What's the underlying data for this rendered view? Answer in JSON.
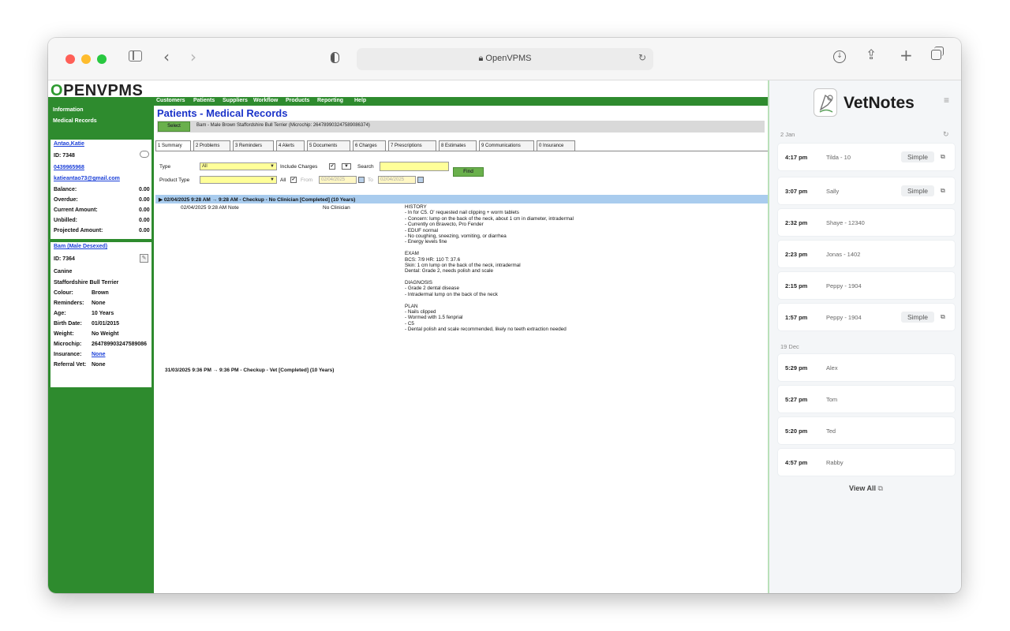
{
  "browser": {
    "url": "OpenVPMS",
    "colors": {
      "close": "#ff5f57",
      "minimize": "#febc2e",
      "maximize": "#28c840"
    }
  },
  "app": {
    "logo_o": "O",
    "logo_rest": "PENVPMS",
    "sidebar_links": [
      "Information",
      "Medical Records"
    ],
    "customer": {
      "name": "Antao,Katie",
      "id_label": "ID:",
      "id": "7348",
      "phone": "0439965968",
      "email": "katieantao73@gmail.com",
      "rows": [
        {
          "label": "Balance:",
          "value": "0.00"
        },
        {
          "label": "Overdue:",
          "value": "0.00"
        },
        {
          "label": "Current Amount:",
          "value": "0.00"
        },
        {
          "label": "Unbilled:",
          "value": "0.00"
        },
        {
          "label": "Projected Amount:",
          "value": "0.00"
        }
      ]
    },
    "patient": {
      "name": "Bam (Male Desexed)",
      "id_label": "ID:",
      "id": "7364",
      "species": "Canine",
      "breed": "Staffordshire Bull Terrier",
      "rows": [
        {
          "label": "Colour:",
          "value": "Brown"
        },
        {
          "label": "Reminders:",
          "value": "None"
        },
        {
          "label": "Age:",
          "value": "10 Years"
        },
        {
          "label": "Birth Date:",
          "value": "01/01/2015"
        },
        {
          "label": "Weight:",
          "value": "No Weight"
        },
        {
          "label": "Microchip:",
          "value": "264789903247589086"
        }
      ],
      "insurance_label": "Insurance:",
      "insurance_value": "None",
      "referral_label": "Referral Vet:",
      "referral_value": "None"
    },
    "menu": [
      "Customers",
      "Patients",
      "Suppliers",
      "Workflow",
      "Products",
      "Reporting",
      "Help"
    ],
    "page_title": "Patients - Medical Records",
    "select_button": "Select",
    "select_text": "Bam - Male Brown Staffordshire Bull Terrier (Microchip: 264789903247589086374)",
    "tabs": [
      "1 Summary",
      "2 Problems",
      "3 Reminders",
      "4 Alerts",
      "5 Documents",
      "6 Charges",
      "7 Prescriptions",
      "8 Estimates",
      "9 Communications",
      "0 Insurance"
    ],
    "filters": {
      "type_label": "Type",
      "type_value": "All",
      "include_charges": "Include Charges",
      "search_label": "Search",
      "product_type_label": "Product Type",
      "all_label": "All",
      "from_label": "From",
      "from_value": "02/04/2025",
      "to_label": "To",
      "to_value": "02/04/2025",
      "find_button": "Find",
      "check_mark": "✔"
    },
    "entry1": {
      "header": "02/04/2025 9:28 AM → 9:28 AM - Checkup - No Clinician [Completed] (10 Years)",
      "note_time": "02/04/2025 9:28 AM  Note",
      "note_clinician": "No Clinician",
      "history": [
        "HISTORY",
        "- In for C5. O' requested nail clipping + worm tablets",
        "- Concern: lump on the back of the neck, about 1 cm in diameter, intradermal",
        "- Currently on Bravecto, Pro Fender",
        "- EDUF normal",
        "- No coughing, sneezing, vomiting, or diarrhea",
        "- Energy levels fine",
        "",
        "EXAM",
        "BCS: 7/9    HR: 110    T: 37.6",
        "Skin: 1 cm lump on the back of the neck, intradermal",
        "Dental: Grade 2, needs polish and scale",
        "",
        "DIAGNOSIS",
        "- Grade 2 dental disease",
        "- Intradermal lump on the back of the neck",
        "",
        "PLAN",
        "- Nails clipped",
        "- Wormed with 1.5 fenprial",
        "- C5",
        "- Dental polish and scale recommended, likely no teeth extraction needed"
      ]
    },
    "entry2": {
      "header": "31/03/2025 9:36 PM → 9:36 PM - Checkup - Vet [Completed] (10 Years)"
    }
  },
  "vetnotes": {
    "title": "VetNotes",
    "groups": [
      {
        "date": "2 Jan",
        "items": [
          {
            "time": "4:17 pm",
            "name": "Tilda - 10",
            "badge": "Simple"
          },
          {
            "time": "3:07 pm",
            "name": "Sally",
            "badge": "Simple"
          },
          {
            "time": "2:32 pm",
            "name": "Shaye - 12340",
            "badge": ""
          },
          {
            "time": "2:23 pm",
            "name": "Jonas - 1402",
            "badge": ""
          },
          {
            "time": "2:15 pm",
            "name": "Peppy - 1904",
            "badge": ""
          },
          {
            "time": "1:57 pm",
            "name": "Peppy - 1904",
            "badge": "Simple"
          }
        ]
      },
      {
        "date": "19 Dec",
        "items": [
          {
            "time": "5:29 pm",
            "name": "Alex",
            "badge": ""
          },
          {
            "time": "5:27 pm",
            "name": "Tom",
            "badge": ""
          },
          {
            "time": "5:20 pm",
            "name": "Ted",
            "badge": ""
          },
          {
            "time": "4:57 pm",
            "name": "Rabby",
            "badge": ""
          }
        ]
      }
    ],
    "view_all": "View All"
  }
}
